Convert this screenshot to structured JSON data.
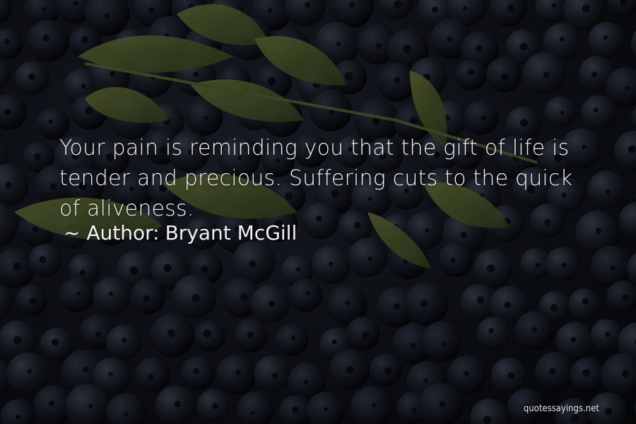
{
  "quote": {
    "text": "Your pain is reminding you that the gift of life is tender and precious. Suffering cuts to the quick of aliveness.",
    "author_prefix": "~ Author:",
    "author_name": "Bryant McGill"
  },
  "watermark": "quotessayings.net",
  "colors": {
    "text": "#f2f2f2",
    "berry": "#1c2230",
    "leaf": "#4b5a2c"
  }
}
